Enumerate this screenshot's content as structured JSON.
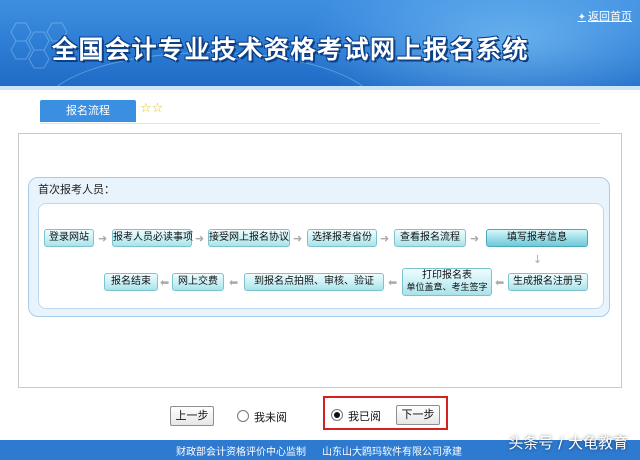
{
  "header": {
    "title": "全国会计专业技术资格考试网上报名系统",
    "home_link": "返回首页",
    "home_icon": "star-icon"
  },
  "tab": {
    "label": "报名流程",
    "stars": "☆☆"
  },
  "panel": {
    "title": "首次报考人员："
  },
  "flow": {
    "steps": [
      "登录网站",
      "报考人员必读事项",
      "接受网上报名协议",
      "选择报考省份",
      "查看报名流程",
      "填写报考信息",
      "生成报名注册号",
      "打印报名表",
      "单位盖章、考生签字",
      "到报名点拍照、审核、验证",
      "网上交费",
      "报名结束"
    ]
  },
  "controls": {
    "prev_label": "上一步",
    "not_read_label": "我未阅",
    "read_label": "我已阅",
    "next_label": "下一步",
    "selected": "read"
  },
  "footer": {
    "left": "财政部会计资格评价中心监制",
    "right": "山东山大鸥玛软件有限公司承建"
  },
  "watermark": "头条号 / 大龟教育",
  "colors": {
    "banner": "#2f7fd6",
    "step_fill": "#c9f0f5",
    "highlight_border": "#d62020",
    "footer": "#2d7ad0"
  }
}
